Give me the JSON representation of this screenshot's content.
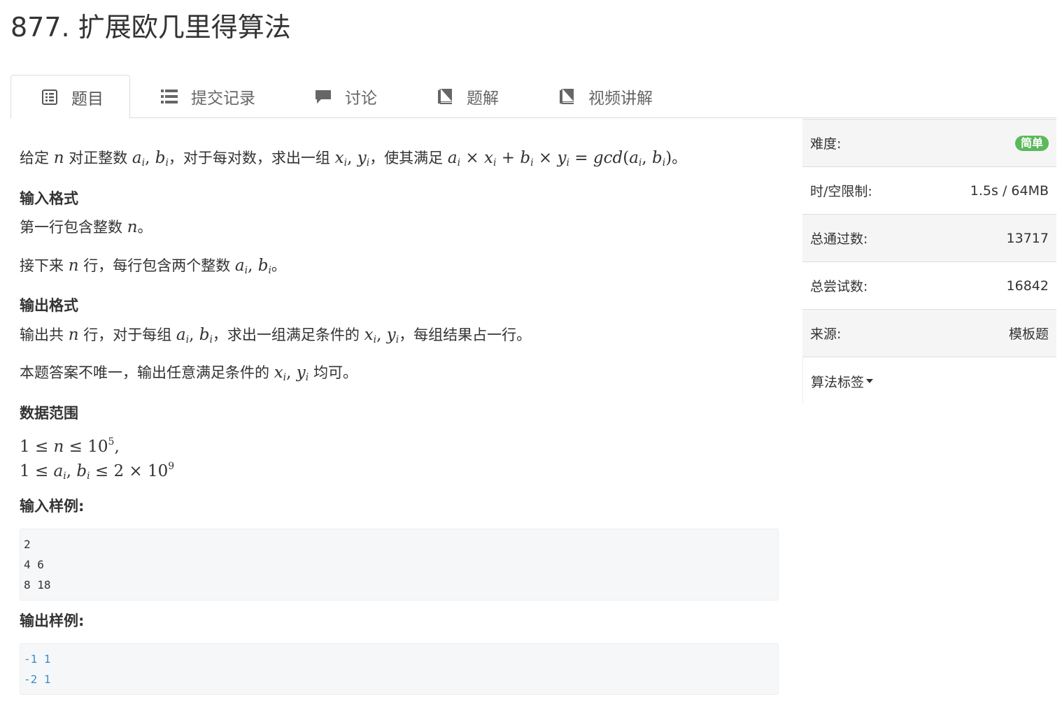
{
  "problem": {
    "title": "877. 扩展欧几里得算法"
  },
  "tabs": [
    {
      "label": "题目",
      "icon": "list-alt-icon"
    },
    {
      "label": "提交记录",
      "icon": "list-icon"
    },
    {
      "label": "讨论",
      "icon": "comment-icon"
    },
    {
      "label": "题解",
      "icon": "book-icon"
    },
    {
      "label": "视频讲解",
      "icon": "book-icon"
    }
  ],
  "statement": {
    "desc_prefix": "给定 ",
    "desc_mid1": " 对正整数 ",
    "desc_mid2": "，对于每对数，求出一组 ",
    "desc_mid3": "，使其满足 ",
    "desc_suffix": "。",
    "input_heading": "输入格式",
    "input_line1_prefix": "第一行包含整数 ",
    "input_line1_suffix": "。",
    "input_line2_prefix": "接下来 ",
    "input_line2_mid": " 行，每行包含两个整数 ",
    "input_line2_suffix": "。",
    "output_heading": "输出格式",
    "output_line1_prefix": "输出共 ",
    "output_line1_mid1": " 行，对于每组 ",
    "output_line1_mid2": "，求出一组满足条件的 ",
    "output_line1_suffix": "，每组结果占一行。",
    "output_line2_prefix": "本题答案不唯一，输出任意满足条件的 ",
    "output_line2_suffix": " 均可。",
    "range_heading": "数据范围",
    "sample_input_heading": "输入样例:",
    "sample_input": "2\n4 6\n8 18",
    "sample_output_heading": "输出样例:",
    "sample_output": "-1 1\n-2 1"
  },
  "sidebar": {
    "difficulty_label": "难度:",
    "difficulty_value": "简单",
    "limit_label": "时/空限制:",
    "limit_value": "1.5s / 64MB",
    "passed_label": "总通过数:",
    "passed_value": "13717",
    "attempts_label": "总尝试数:",
    "attempts_value": "16842",
    "source_label": "来源:",
    "source_value": "模板题",
    "tags_label": "算法标签"
  },
  "colors": {
    "badge_easy": "#5cb85c",
    "sample_output_text": "#3e8fc9"
  }
}
